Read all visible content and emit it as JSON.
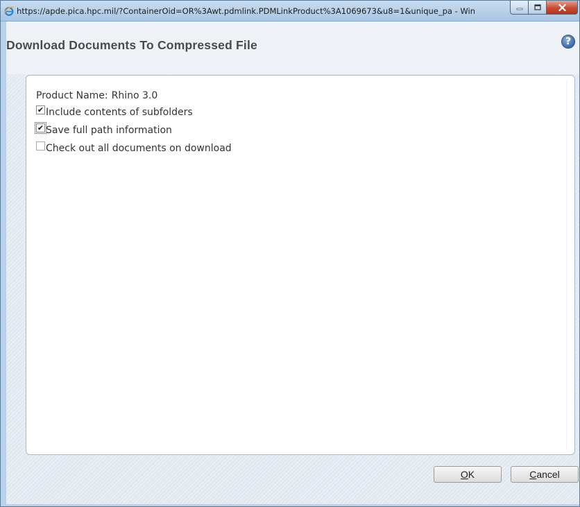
{
  "window": {
    "title": "https://apde.pica.hpc.mil/?ContainerOid=OR%3Awt.pdmlink.PDMLinkProduct%3A1069673&u8=1&unique_pa - Windo...",
    "buttons": {
      "minimize": "—",
      "maximize": "□",
      "close": "X"
    }
  },
  "dialog": {
    "title": "Download Documents To Compressed File",
    "help_symbol": "?"
  },
  "form": {
    "product_label": "Product Name:",
    "product_value": "Rhino 3.0",
    "options": [
      {
        "label": "Include contents of subfolders",
        "checked": true
      },
      {
        "label": "Save full path information",
        "checked": true
      },
      {
        "label": "Check out all documents on download",
        "checked": false
      }
    ]
  },
  "footer": {
    "ok": {
      "accel": "O",
      "rest": "K"
    },
    "cancel": {
      "accel": "C",
      "rest": "ancel"
    }
  },
  "colors": {
    "titlebar": "#b9d1ea",
    "close_button": "#c74d35",
    "header_background": "#eef1f6",
    "header_text": "#4b4b4b"
  }
}
